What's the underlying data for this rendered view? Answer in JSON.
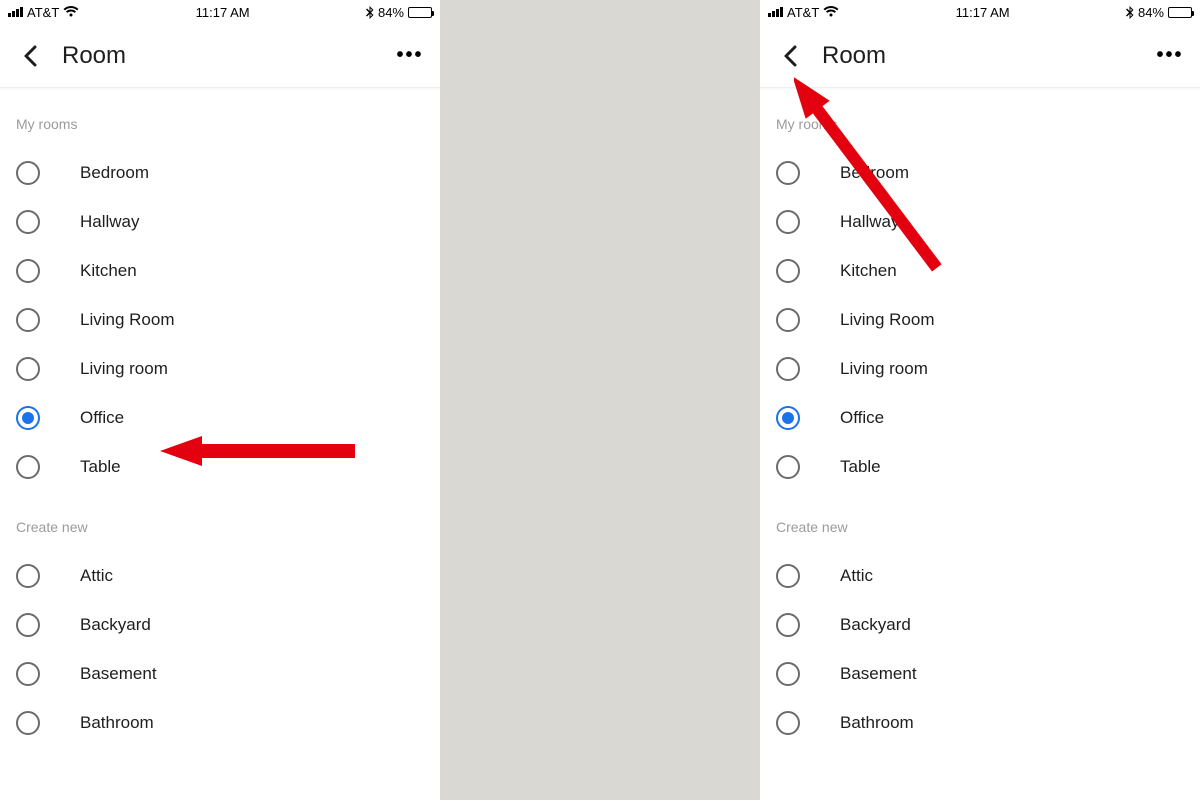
{
  "status": {
    "carrier": "AT&T",
    "time": "11:17 AM",
    "bluetooth_glyph": "✻",
    "battery_pct": "84%"
  },
  "header": {
    "title": "Room",
    "more_glyph": "•••"
  },
  "sections": {
    "my_rooms_label": "My rooms",
    "create_new_label": "Create new"
  },
  "my_rooms": [
    {
      "label": "Bedroom",
      "selected": false
    },
    {
      "label": "Hallway",
      "selected": false
    },
    {
      "label": "Kitchen",
      "selected": false
    },
    {
      "label": "Living Room",
      "selected": false
    },
    {
      "label": "Living room",
      "selected": false
    },
    {
      "label": "Office",
      "selected": true
    },
    {
      "label": "Table",
      "selected": false
    }
  ],
  "create_new": [
    {
      "label": "Attic"
    },
    {
      "label": "Backyard"
    },
    {
      "label": "Basement"
    },
    {
      "label": "Bathroom"
    }
  ],
  "annotation": {
    "left_arrow_targets": "office-radio",
    "right_arrow_targets": "back-button",
    "color": "#e3000f"
  }
}
